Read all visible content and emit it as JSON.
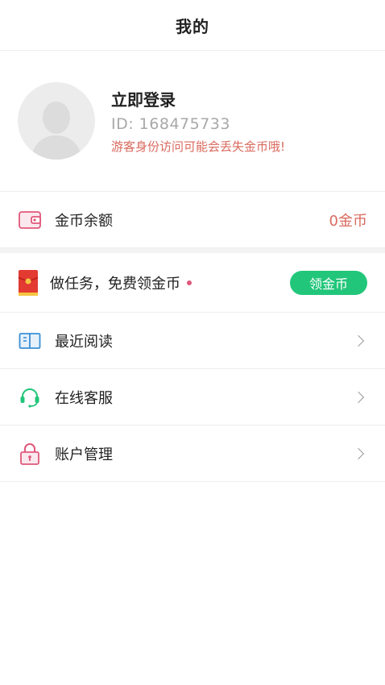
{
  "header": {
    "title": "我的"
  },
  "profile": {
    "login_label": "立即登录",
    "user_id": "ID: 168475733",
    "warning": "游客身份访问可能会丢失金币哦!"
  },
  "coin": {
    "label": "金币余额",
    "value": "0金币"
  },
  "task": {
    "label": "做任务，免费领金币",
    "button": "领金币"
  },
  "menu": [
    {
      "label": "最近阅读",
      "icon": "book-icon"
    },
    {
      "label": "在线客服",
      "icon": "headset-icon"
    },
    {
      "label": "账户管理",
      "icon": "lock-icon"
    }
  ],
  "colors": {
    "accent_red": "#d96a5e",
    "green": "#22c67a",
    "pink": "#e0577a",
    "blue": "#3a8fd6"
  }
}
